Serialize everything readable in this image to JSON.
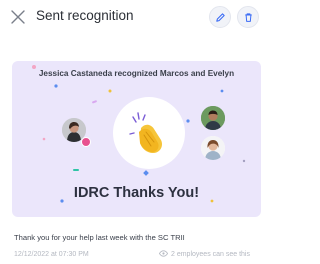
{
  "header": {
    "title": "Sent recognition",
    "close_icon": "close-icon",
    "edit_icon": "pencil-icon",
    "delete_icon": "trash-icon",
    "accent_color": "#3b6cf5"
  },
  "card": {
    "heading": "Jessica Castaneda recognized Marcos and Evelyn",
    "footer_title": "IDRC Thanks You!",
    "background_color": "#ebe6fb",
    "center_icon": "clapping-hands-icon"
  },
  "message": {
    "text": "Thank you for your help last week with the SC TRII",
    "timestamp": "12/12/2022 at 07:30 PM",
    "visibility": "2 employees can see this"
  }
}
